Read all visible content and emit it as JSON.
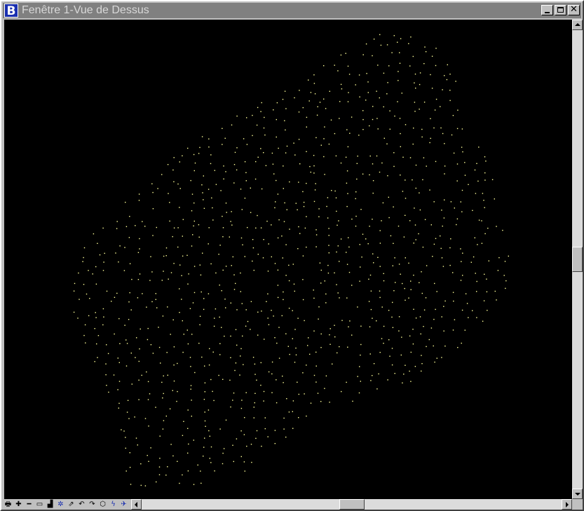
{
  "window": {
    "title": "Fenêtre 1-Vue de Dessus",
    "app_icon": "B",
    "buttons": [
      "minimize",
      "maximize",
      "close"
    ]
  },
  "view": {
    "background": "#000000",
    "point_color": "#ffff99"
  },
  "toolbar": {
    "tools": [
      {
        "name": "update-icon",
        "glyph": "🖶"
      },
      {
        "name": "zoom-in-icon",
        "glyph": "✚"
      },
      {
        "name": "zoom-out-icon",
        "glyph": "━"
      },
      {
        "name": "window-area-icon",
        "glyph": "▭"
      },
      {
        "name": "fit-view-icon",
        "glyph": "▟"
      },
      {
        "name": "rotate-view-icon",
        "glyph": "✲"
      },
      {
        "name": "pan-view-icon",
        "glyph": "⇗"
      },
      {
        "name": "view-previous-icon",
        "glyph": "↶"
      },
      {
        "name": "view-next-icon",
        "glyph": "↷"
      },
      {
        "name": "3d-view-icon",
        "glyph": "⬡"
      },
      {
        "name": "display-settings-icon",
        "glyph": "ϟ"
      },
      {
        "name": "camera-icon",
        "glyph": "✈"
      }
    ]
  }
}
